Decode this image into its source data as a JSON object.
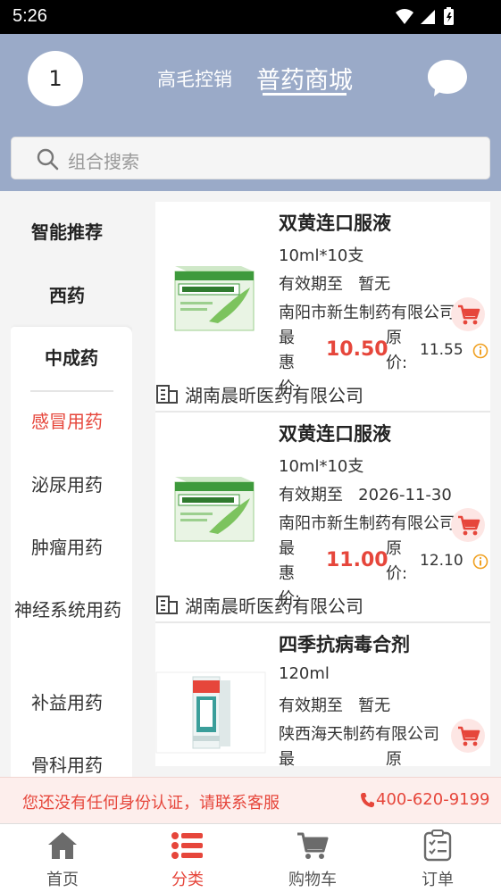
{
  "status_bar": {
    "time": "5:26"
  },
  "header": {
    "avatar_text": "1",
    "tabs": [
      {
        "label": "高毛控销"
      },
      {
        "label": "普药商城"
      }
    ],
    "active_tab": "普药商城"
  },
  "search": {
    "placeholder": "组合搜索"
  },
  "sidebar": {
    "items": [
      {
        "label": "智能推荐"
      },
      {
        "label": "西药"
      },
      {
        "label": "中成药"
      },
      {
        "label": "感冒用药"
      },
      {
        "label": "泌尿用药"
      },
      {
        "label": "肿瘤用药"
      },
      {
        "label": "神经系统用药"
      },
      {
        "label": "补益用药"
      },
      {
        "label": "骨科用药"
      }
    ],
    "active": "感冒用药"
  },
  "products": [
    {
      "name": "双黄连口服液",
      "spec": "10ml*10支",
      "expiry_label": "有效期至",
      "expiry": "暂无",
      "manufacturer": "南阳市新生制药有限公司",
      "best_price_label": "最惠价:",
      "best_price": "10.50",
      "orig_price_label": "原价:",
      "orig_price": "11.55",
      "supplier": "湖南晨昕医药有限公司"
    },
    {
      "name": "双黄连口服液",
      "spec": "10ml*10支",
      "expiry_label": "有效期至",
      "expiry": "2026-11-30",
      "manufacturer": "南阳市新生制药有限公司",
      "best_price_label": "最惠价:",
      "best_price": "11.00",
      "orig_price_label": "原价:",
      "orig_price": "12.10",
      "supplier": "湖南晨昕医药有限公司"
    },
    {
      "name": "四季抗病毒合剂",
      "spec": "120ml",
      "expiry_label": "有效期至",
      "expiry": "暂无",
      "manufacturer": "陕西海天制药有限公司",
      "best_price_label": "最惠价:",
      "orig_price_label": "原价:"
    }
  ],
  "notice": {
    "text": "您还没有任何身份认证，请联系客服",
    "phone": "400-620-9199"
  },
  "bottom_nav": [
    {
      "label": "首页"
    },
    {
      "label": "分类"
    },
    {
      "label": "购物车"
    },
    {
      "label": "订单"
    }
  ],
  "colors": {
    "accent": "#e6463b",
    "header_bg": "#9aaac8"
  }
}
